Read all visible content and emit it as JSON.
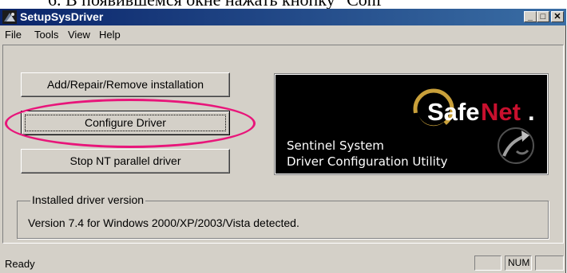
{
  "doc_caption": "6. В появившемся окне нажать кнопку \"Conf",
  "window": {
    "title": "SetupSysDriver",
    "controls": {
      "minimize": "_",
      "maximize": "□",
      "close": "✕"
    }
  },
  "menu": [
    "File",
    "Tools",
    "View",
    "Help"
  ],
  "buttons": {
    "add_repair_remove": "Add/Repair/Remove installation",
    "configure_driver": "Configure Driver",
    "stop_nt_parallel": "Stop NT parallel driver"
  },
  "logo": {
    "brand_safe": "Safe",
    "brand_net": "Net",
    "brand_dot": ".",
    "line1": "Sentinel System",
    "line2": "Driver Configuration Utility"
  },
  "installed": {
    "group_title": "Installed driver version",
    "version_text": "Version 7.4 for Windows 2000/XP/2003/Vista detected."
  },
  "status": {
    "ready": "Ready",
    "num": "NUM"
  },
  "colors": {
    "titlebar": "#0a246a",
    "highlight": "#e8157a",
    "safenet_red": "#c8102e"
  }
}
